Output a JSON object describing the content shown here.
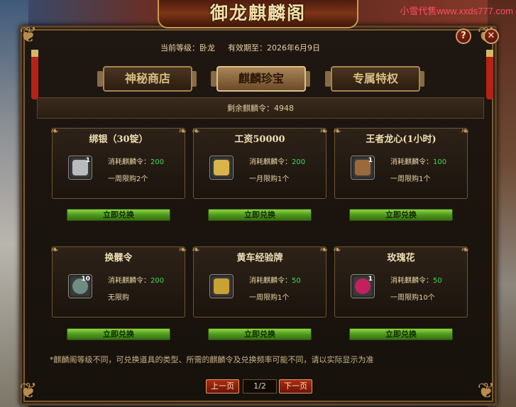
{
  "header": {
    "title": "御龙麒麟阁",
    "watermark": "小雪代售www.xxds777.com",
    "help_label": "?",
    "close_label": "✕"
  },
  "info": {
    "level_label": "当前等级：卧龙",
    "expiry_label": "有效期至：2026年6月9日"
  },
  "tabs": [
    {
      "label": "神秘商店",
      "active": false
    },
    {
      "label": "麒麟珍宝",
      "active": true
    },
    {
      "label": "专属特权",
      "active": false
    }
  ],
  "remaining": "剩余麒麟令：4948",
  "items": [
    {
      "title": "绑银（30锭）",
      "cost_label": "消耗麒麟令：",
      "cost": "200",
      "limit": "一周限购2个",
      "count": "1",
      "icon": "silver-ingot-icon",
      "icon_color": "#b9bcbf",
      "button": "立即兑换"
    },
    {
      "title": "工资50000",
      "cost_label": "消耗麒麟令：",
      "cost": "200",
      "limit": "一月限购1个",
      "count": "",
      "icon": "gold-bag-icon",
      "icon_color": "#d8b44a",
      "button": "立即兑换"
    },
    {
      "title": "王者龙心(1小时)",
      "cost_label": "消耗麒麟令：",
      "cost": "100",
      "limit": "一周限购1个",
      "count": "1",
      "icon": "dragon-heart-icon",
      "icon_color": "#9a6a3c",
      "button": "立即兑换"
    },
    {
      "title": "换髁令",
      "cost_label": "消耗麒麟令：",
      "cost": "200",
      "limit": "无限购",
      "count": "10",
      "icon": "token-icon",
      "icon_color": "#6f8d83",
      "button": "立即兑换"
    },
    {
      "title": "黄车经验牌",
      "cost_label": "消耗麒麟令：",
      "cost": "50",
      "limit": "一周限购1个",
      "count": "",
      "icon": "yellow-cart-icon",
      "icon_color": "#c9a233",
      "button": "立即兑换"
    },
    {
      "title": "玫瑰花",
      "cost_label": "消耗麒麟令：",
      "cost": "50",
      "limit": "一周限购10个",
      "count": "1",
      "icon": "rose-icon",
      "icon_color": "#c3205f",
      "button": "立即兑换"
    }
  ],
  "note": "*麒麟阁等级不同，可兑换道具的类型、所需的麒麟令及兑换频率可能不同，请以实际显示为准",
  "pager": {
    "prev": "上一页",
    "current": "1/2",
    "next": "下一页"
  }
}
